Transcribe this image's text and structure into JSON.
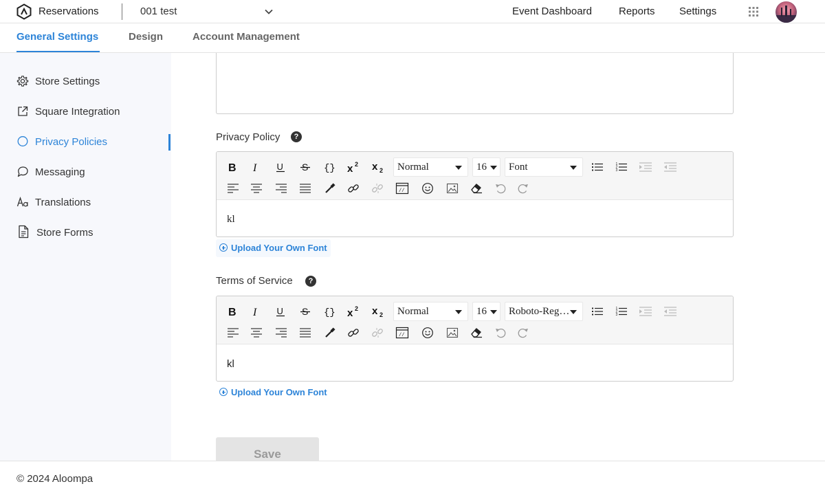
{
  "header": {
    "app_name": "Reservations",
    "store_name": "001 test",
    "nav": [
      "Event Dashboard",
      "Reports",
      "Settings"
    ]
  },
  "tabs": [
    "General Settings",
    "Design",
    "Account Management"
  ],
  "active_tab": "General Settings",
  "sidebar": {
    "items": [
      {
        "label": "Store Settings",
        "icon": "gear-icon"
      },
      {
        "label": "Square Integration",
        "icon": "external-link-icon"
      },
      {
        "label": "Privacy Policies",
        "icon": "circle-icon"
      },
      {
        "label": "Messaging",
        "icon": "chat-bubble-icon"
      },
      {
        "label": "Translations",
        "icon": "font-aa-icon"
      },
      {
        "label": "Store Forms",
        "icon": "document-icon"
      }
    ],
    "active_item": "Privacy Policies"
  },
  "privacy_policy": {
    "label": "Privacy Policy",
    "format": "Normal",
    "size": "16",
    "font": "Font",
    "content": "kl",
    "upload_label": "Upload Your Own Font"
  },
  "terms_of_service": {
    "label": "Terms of Service",
    "format": "Normal",
    "size": "16",
    "font": "Roboto-Reg…",
    "content": "kl",
    "upload_label": "Upload Your Own Font"
  },
  "save_label": "Save",
  "footer": {
    "copyright": "© 2024 Aloompa"
  },
  "colors": {
    "accent": "#2d84d8",
    "sidebar_bg": "#f7f8fc"
  }
}
